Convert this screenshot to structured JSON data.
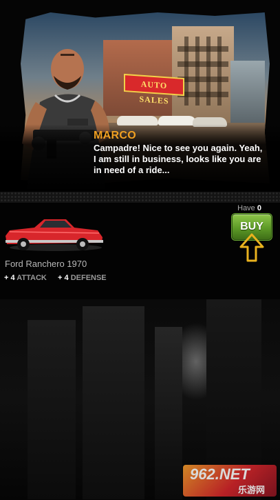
{
  "dialog": {
    "speaker": "MARCO",
    "text": "Campadre! Nice to see you again. Yeah, I am still in business, looks like you are in need of a ride...",
    "scene_sign": "AUTO SALES"
  },
  "item": {
    "name": "Ford Ranchero 1970",
    "have_label": "Have",
    "have_count": "0",
    "buy_label": "BUY",
    "stats": [
      {
        "prefix": "+",
        "value": "4",
        "label": "ATTACK"
      },
      {
        "prefix": "+",
        "value": "4",
        "label": "DEFENSE"
      }
    ],
    "car_color": "#d8262b"
  },
  "watermark": {
    "number": "962.NET",
    "sub": "乐游网"
  },
  "colors": {
    "speaker": "#f0a022",
    "buy_button": "#5d9a27",
    "arrow": "#e9b21e"
  }
}
